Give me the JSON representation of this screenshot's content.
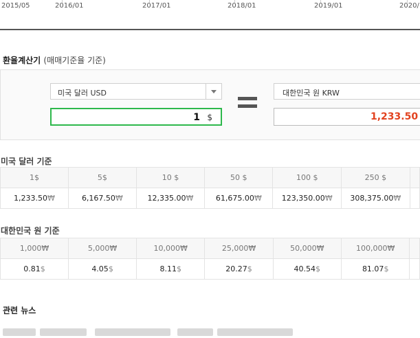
{
  "chart_axis": {
    "ticks": [
      "2015/05",
      "2016/01",
      "2017/01",
      "2018/01",
      "2019/01",
      "2020/"
    ]
  },
  "calculator": {
    "title": "환율계산기",
    "subtitle": "(매매기준율 기준)",
    "from_currency": "미국 달러 USD",
    "from_amount": "1",
    "from_unit": "$",
    "to_currency": "대한민국 원 KRW",
    "to_amount": "1,233.50"
  },
  "usd_table": {
    "title": "미국 달러 기준",
    "headers": [
      "1$",
      "5$",
      "10 $",
      "50 $",
      "100 $",
      "250 $"
    ],
    "values": [
      "1,233.50",
      "6,167.50",
      "12,335.00",
      "61,675.00",
      "123,350.00",
      "308,375.00"
    ],
    "value_unit": "₩"
  },
  "krw_table": {
    "title": "대한민국 원 기준",
    "headers": [
      "1,000₩",
      "5,000₩",
      "10,000₩",
      "25,000₩",
      "50,000₩",
      "100,000₩"
    ],
    "values": [
      "0.81",
      "4.05",
      "8.11",
      "20.27",
      "40.54",
      "81.07"
    ],
    "value_unit": "$"
  },
  "news": {
    "title": "관련 뉴스"
  },
  "colors": {
    "amount_border": "#2db84b",
    "result_text": "#e2421f"
  }
}
